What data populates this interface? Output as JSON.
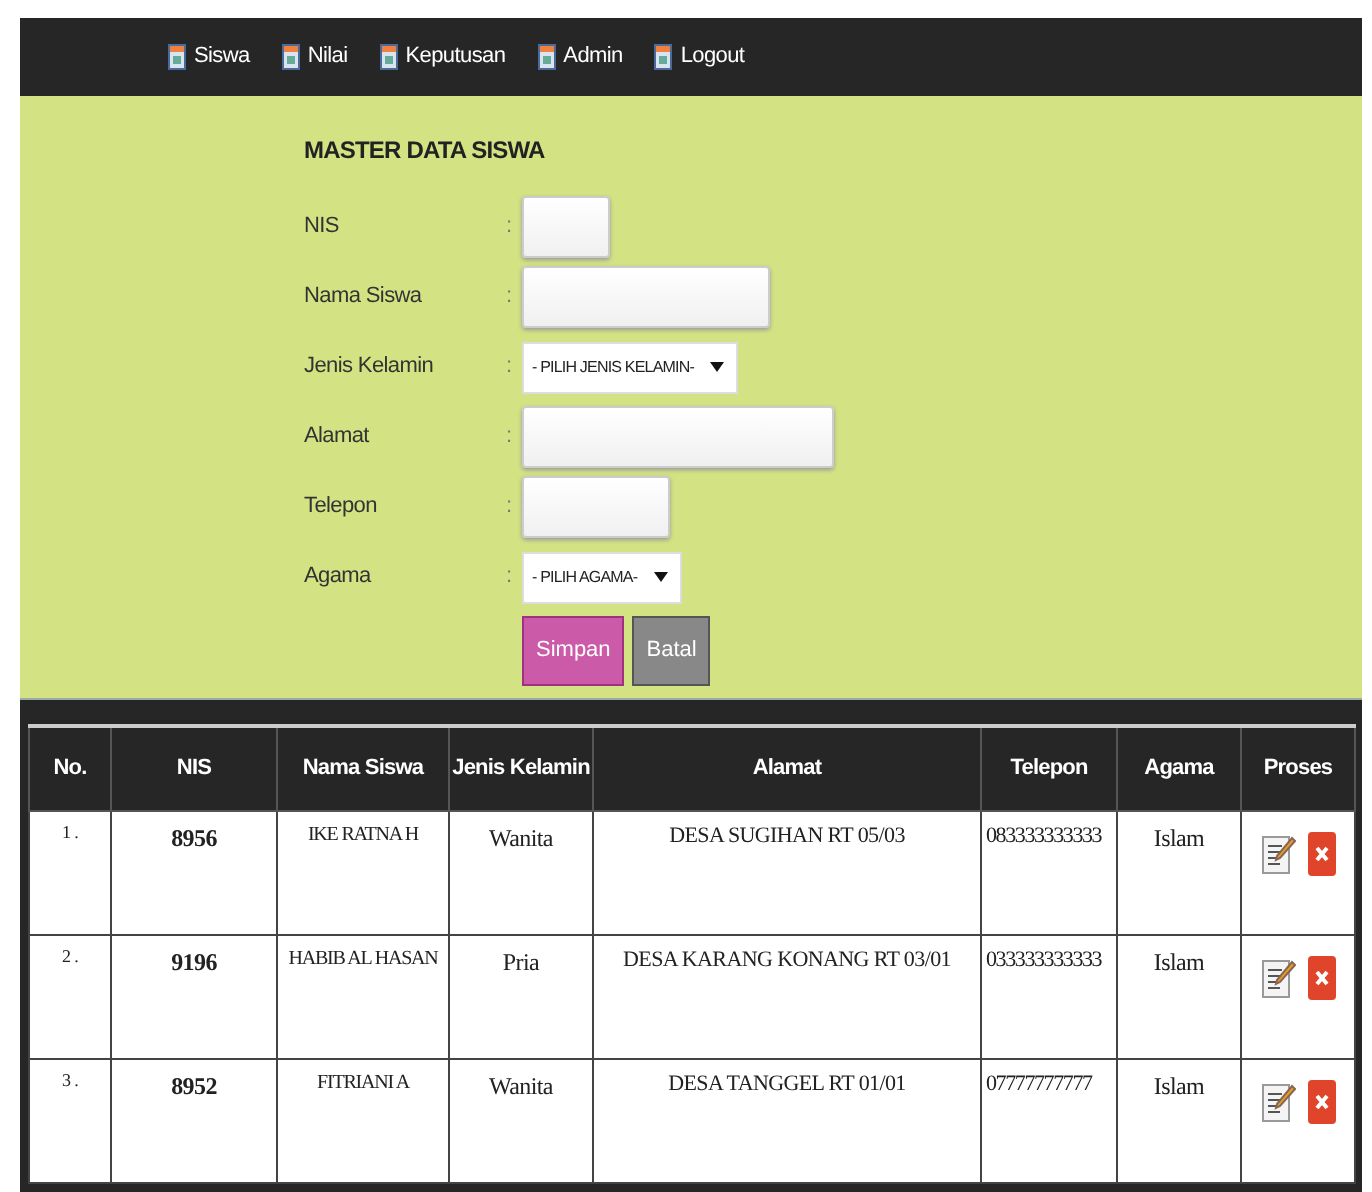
{
  "nav": {
    "items": [
      {
        "label": "Siswa"
      },
      {
        "label": "Nilai"
      },
      {
        "label": "Keputusan"
      },
      {
        "label": "Admin"
      },
      {
        "label": "Logout"
      }
    ]
  },
  "form": {
    "title": "MASTER DATA SISWA",
    "separator": ":",
    "fields": [
      {
        "label": "NIS",
        "kind": "text"
      },
      {
        "label": "Nama Siswa",
        "kind": "text"
      },
      {
        "label": "Jenis Kelamin",
        "kind": "select",
        "value": "- PILIH JENIS KELAMIN-"
      },
      {
        "label": "Alamat",
        "kind": "text"
      },
      {
        "label": "Telepon",
        "kind": "text"
      },
      {
        "label": "Agama",
        "kind": "select",
        "value": "- PILIH AGAMA-"
      }
    ],
    "buttons": [
      {
        "label": "Simpan",
        "kind": "primary"
      },
      {
        "label": "Batal",
        "kind": "secondary"
      }
    ]
  },
  "table": {
    "columns": [
      "No.",
      "NIS",
      "Nama Siswa",
      "Jenis Kelamin",
      "Alamat",
      "Telepon",
      "Agama",
      "Proses"
    ],
    "rows": [
      {
        "no": "1 .",
        "nis": "8956",
        "nama": "IKE RATNA H",
        "jenis_kelamin": "Wanita",
        "alamat": "DESA SUGIHAN RT 05/03",
        "telepon": "083333333333",
        "agama": "Islam"
      },
      {
        "no": "2 .",
        "nis": "9196",
        "nama": "HABIB AL HASAN",
        "jenis_kelamin": "Pria",
        "alamat": "DESA KARANG KONANG RT 03/01",
        "telepon": "033333333333",
        "agama": "Islam"
      },
      {
        "no": "3 .",
        "nis": "8952",
        "nama": "FITRIANI A",
        "jenis_kelamin": "Wanita",
        "alamat": "DESA TANGGEL RT 01/01",
        "telepon": "07777777777",
        "agama": "Islam"
      }
    ]
  }
}
